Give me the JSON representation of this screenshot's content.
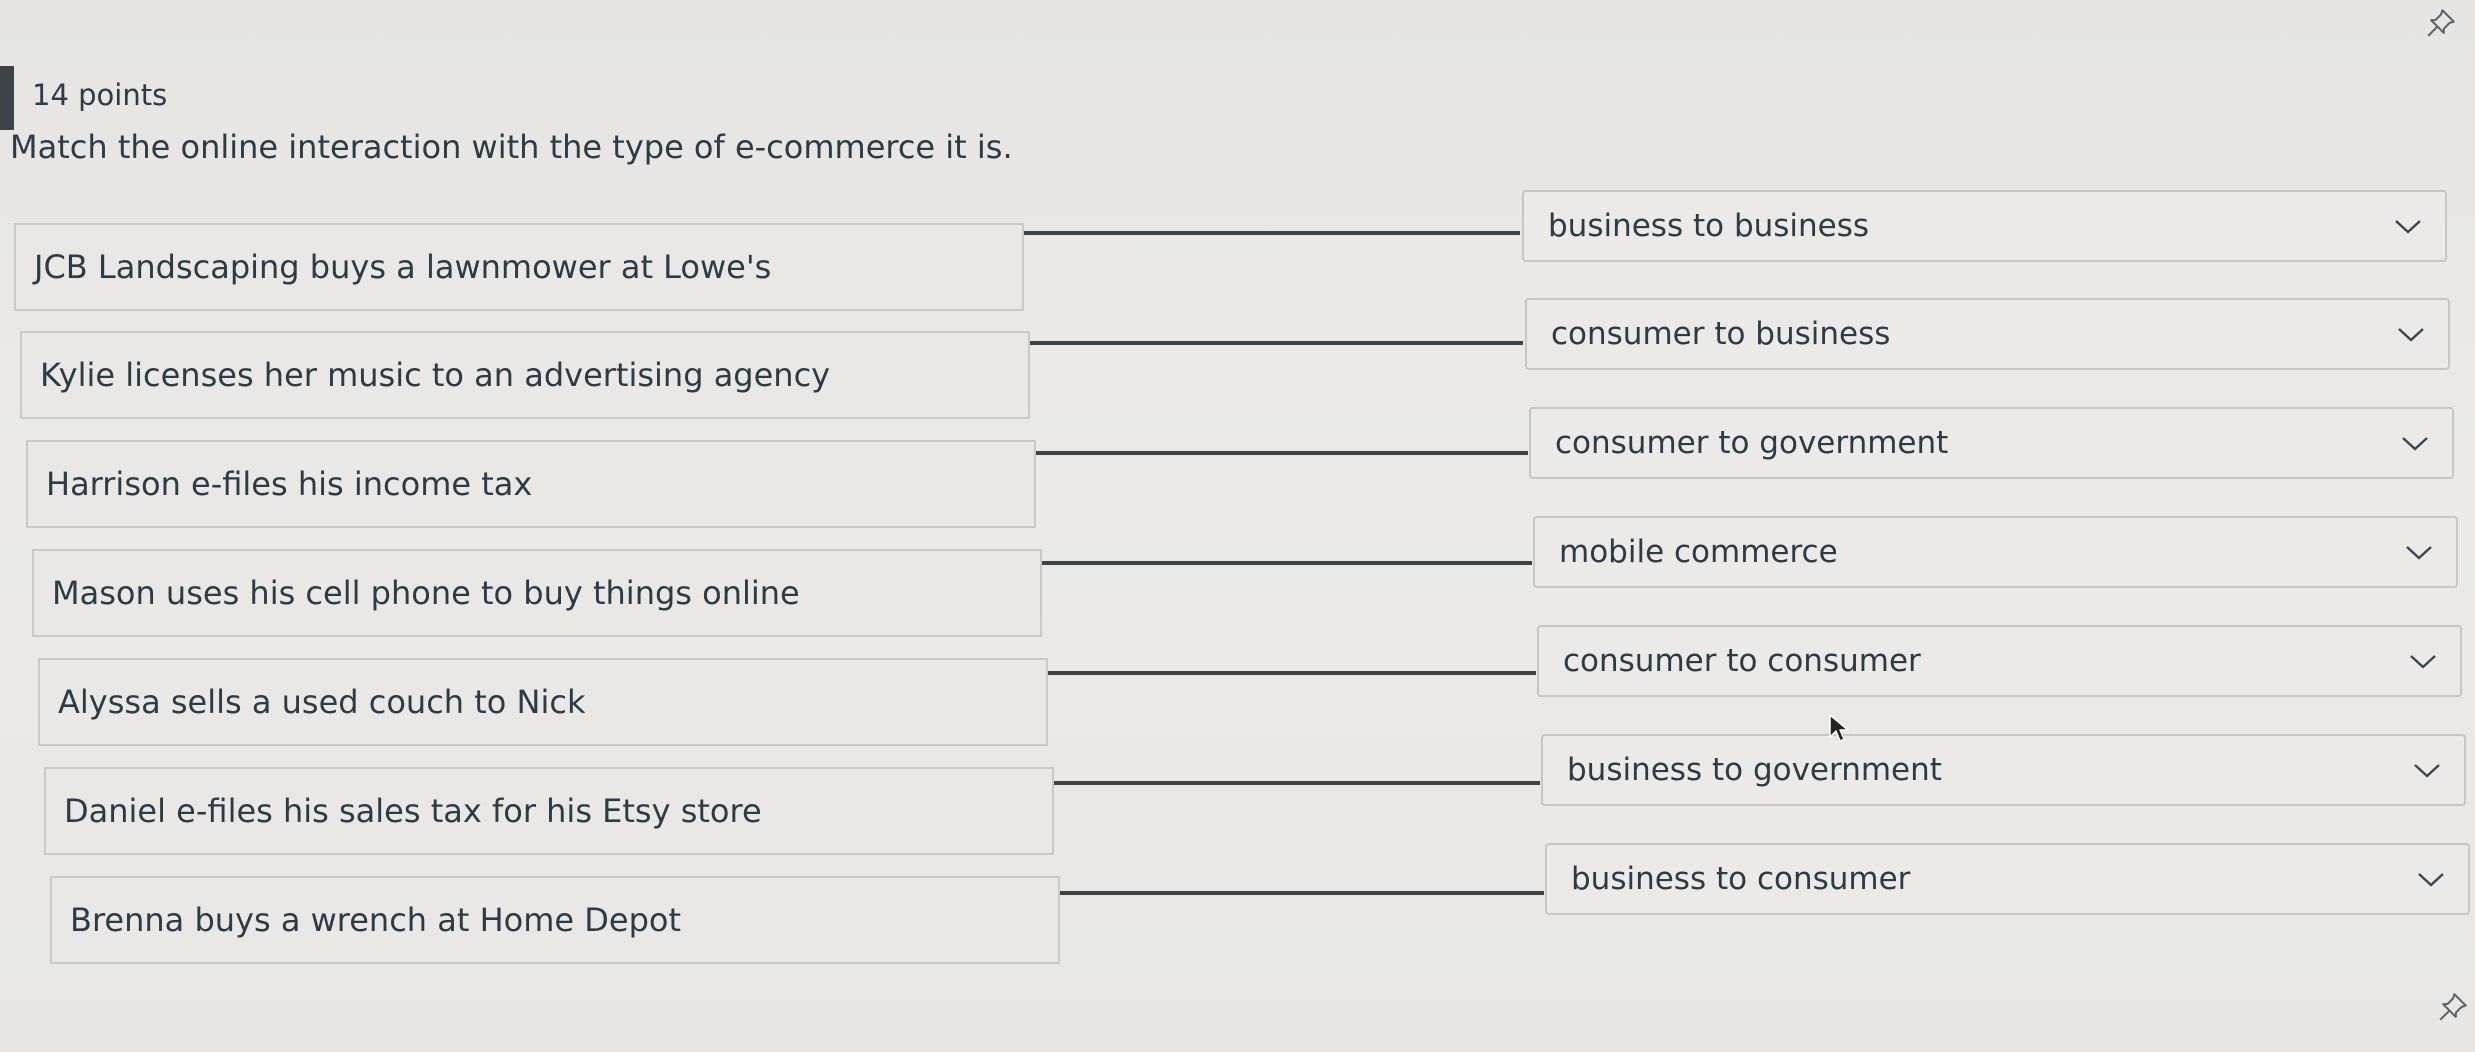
{
  "question": {
    "points": "14 points",
    "prompt": "Match the online interaction with the type of e-commerce it is."
  },
  "items": [
    {
      "prompt": "JCB Landscaping buys a lawnmower at Lowe's",
      "answer": "business to business"
    },
    {
      "prompt": "Kylie licenses her music to an advertising agency",
      "answer": "consumer to business"
    },
    {
      "prompt": "Harrison e-files his income tax",
      "answer": "consumer to government"
    },
    {
      "prompt": "Mason uses his cell phone to buy things online",
      "answer": "mobile commerce"
    },
    {
      "prompt": "Alyssa sells a used couch to Nick",
      "answer": "consumer to consumer"
    },
    {
      "prompt": "Daniel e-files his sales tax for his Etsy store",
      "answer": "business to government"
    },
    {
      "prompt": "Brenna buys a wrench at Home Depot",
      "answer": "business to consumer"
    }
  ],
  "icons": {
    "select_arrow": "chevron-down-icon",
    "pin": "pin-icon",
    "cursor": "mouse-cursor-icon"
  }
}
